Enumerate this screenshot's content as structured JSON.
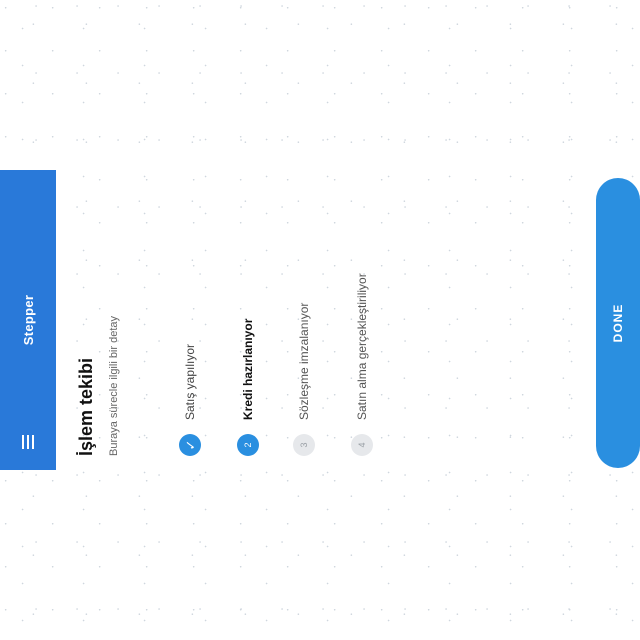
{
  "appbar": {
    "title": "Stepper",
    "menu_icon": "hamburger-icon"
  },
  "main": {
    "heading": "İşlem tekibi",
    "subtitle": "Buraya sürecle ilgili bir detay",
    "steps": [
      {
        "number": "",
        "label": "Satış yapılıyor",
        "status": "done",
        "icon": "check-icon"
      },
      {
        "number": "2",
        "label": "Kredi hazırlanıyor",
        "status": "active"
      },
      {
        "number": "3",
        "label": "Sözleşme imzalanıyor",
        "status": "pending"
      },
      {
        "number": "4",
        "label": "Satın alma gerçekleştiriliyor",
        "status": "pending"
      }
    ]
  },
  "footer": {
    "done_label": "DONE"
  },
  "colors": {
    "appbar": "#2979d9",
    "accent": "#2a8fe0",
    "pending": "#e6e8eb"
  }
}
